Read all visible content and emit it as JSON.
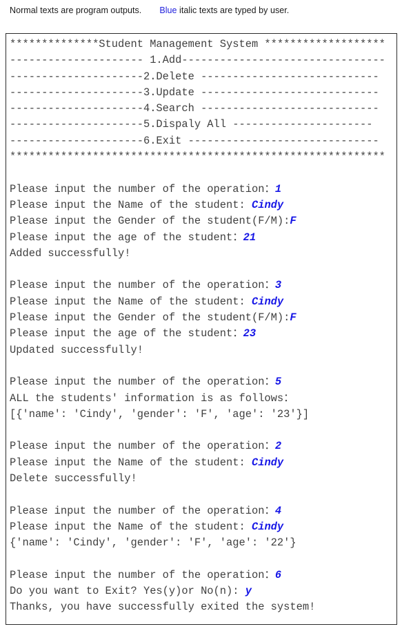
{
  "caption": {
    "normal_prefix": "Normal texts are program outputs.",
    "blue_word": "Blue",
    "normal_suffix": " italic texts are typed by user."
  },
  "colors": {
    "user_text": "#1616e6",
    "program_text": "#3f3f3f",
    "box_border": "#2b2b2b",
    "background": "#ffffff"
  },
  "console": {
    "title": "Student Management System",
    "menu": {
      "banner_top": "**************Student Management System *******************",
      "banner_bottom": "***********************************************************",
      "items": [
        "--------------------- 1.Add--------------------------------",
        "---------------------2.Delete ----------------------------",
        "---------------------3.Update ----------------------------",
        "---------------------4.Search ----------------------------",
        "---------------------5.Dispaly All ----------------------",
        "---------------------6.Exit ------------------------------"
      ]
    },
    "lines": [
      {
        "text": "**************Student Management System *******************",
        "user": ""
      },
      {
        "text": "--------------------- 1.Add--------------------------------",
        "user": ""
      },
      {
        "text": "---------------------2.Delete ----------------------------",
        "user": ""
      },
      {
        "text": "---------------------3.Update ----------------------------",
        "user": ""
      },
      {
        "text": "---------------------4.Search ----------------------------",
        "user": ""
      },
      {
        "text": "---------------------5.Dispaly All ----------------------",
        "user": ""
      },
      {
        "text": "---------------------6.Exit ------------------------------",
        "user": ""
      },
      {
        "text": "***********************************************************",
        "user": ""
      },
      {
        "text": "",
        "user": ""
      },
      {
        "text": "Please input the number of the operation：",
        "user": "1"
      },
      {
        "text": "Please input the Name of the student: ",
        "user": "Cindy"
      },
      {
        "text": "Please input the Gender of the student(F/M):",
        "user": "F"
      },
      {
        "text": "Please input the age of the student：",
        "user": "21"
      },
      {
        "text": "Added successfully!",
        "user": ""
      },
      {
        "text": "",
        "user": ""
      },
      {
        "text": "Please input the number of the operation：",
        "user": "3"
      },
      {
        "text": "Please input the Name of the student: ",
        "user": "Cindy"
      },
      {
        "text": "Please input the Gender of the student(F/M):",
        "user": "F"
      },
      {
        "text": "Please input the age of the student：",
        "user": "23"
      },
      {
        "text": "Updated successfully!",
        "user": ""
      },
      {
        "text": "",
        "user": ""
      },
      {
        "text": "Please input the number of the operation：",
        "user": "5"
      },
      {
        "text": "ALL the students' information is as follows：",
        "user": ""
      },
      {
        "text": "[{'name': 'Cindy', 'gender': 'F', 'age': '23'}]",
        "user": ""
      },
      {
        "text": "",
        "user": ""
      },
      {
        "text": "Please input the number of the operation：",
        "user": "2"
      },
      {
        "text": "Please input the Name of the student: ",
        "user": "Cindy"
      },
      {
        "text": "Delete successfully!",
        "user": ""
      },
      {
        "text": "",
        "user": ""
      },
      {
        "text": "Please input the number of the operation：",
        "user": "4"
      },
      {
        "text": "Please input the Name of the student: ",
        "user": "Cindy"
      },
      {
        "text": "{'name': 'Cindy', 'gender': 'F', 'age': '22'}",
        "user": ""
      },
      {
        "text": "",
        "user": ""
      },
      {
        "text": "Please input the number of the operation：",
        "user": "6"
      },
      {
        "text": "Do you want to Exit? Yes(y)or No(n): ",
        "user": "y"
      },
      {
        "text": "Thanks, you have successfully exited the system!",
        "user": ""
      }
    ]
  }
}
